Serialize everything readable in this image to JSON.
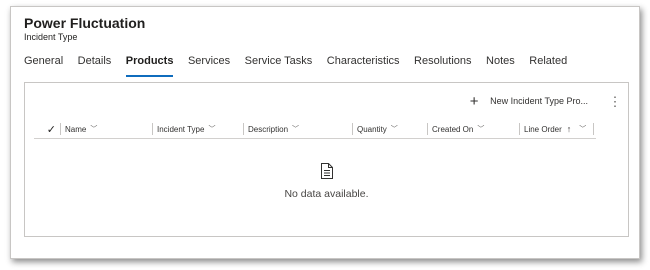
{
  "record": {
    "title": "Power Fluctuation",
    "entity": "Incident Type"
  },
  "tabs": [
    {
      "label": "General",
      "active": false
    },
    {
      "label": "Details",
      "active": false
    },
    {
      "label": "Products",
      "active": true
    },
    {
      "label": "Services",
      "active": false
    },
    {
      "label": "Service Tasks",
      "active": false
    },
    {
      "label": "Characteristics",
      "active": false
    },
    {
      "label": "Resolutions",
      "active": false
    },
    {
      "label": "Notes",
      "active": false
    },
    {
      "label": "Related",
      "active": false
    }
  ],
  "commandbar": {
    "new_label": "New Incident Type Pro...",
    "new_icon": "plus-icon",
    "more_icon": "more-vertical-icon"
  },
  "grid": {
    "columns": [
      {
        "label": "Name",
        "icon": "chevron-down-icon"
      },
      {
        "label": "Incident Type",
        "icon": "chevron-down-icon"
      },
      {
        "label": "Description",
        "icon": "chevron-down-icon"
      },
      {
        "label": "Quantity",
        "icon": "chevron-down-icon"
      },
      {
        "label": "Created On",
        "icon": "chevron-down-icon"
      },
      {
        "label": "Line Order",
        "sort_icon": "sort-ascending-icon",
        "icon": "chevron-down-icon"
      }
    ],
    "select_all_icon": "checkmark-icon",
    "empty_message": "No data available.",
    "empty_icon": "document-icon"
  },
  "colors": {
    "accent": "#0f6cbd",
    "border": "#c8c6c4"
  }
}
